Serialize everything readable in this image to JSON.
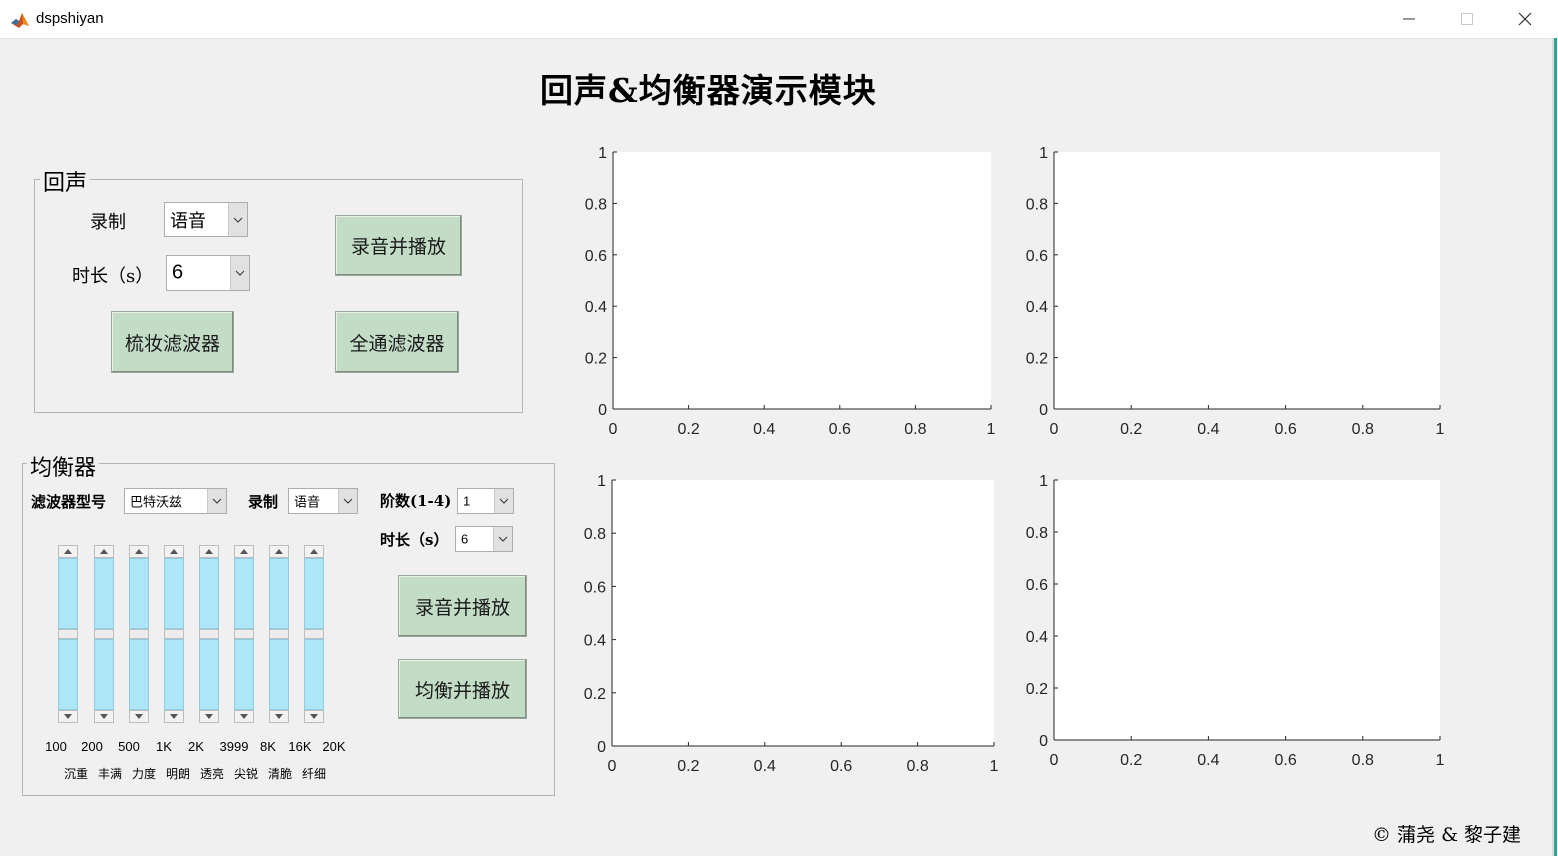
{
  "window": {
    "title": "dspshiyan"
  },
  "main_title": "回声&均衡器演示模块",
  "echo": {
    "panel_title": "回声",
    "record_label": "录制",
    "record_value": "语音",
    "duration_label": "时长（s）",
    "duration_value": "6",
    "record_play_button": "录音并播放",
    "comb_filter_button": "梳妆滤波器",
    "allpass_filter_button": "全通滤波器"
  },
  "equalizer": {
    "panel_title": "均衡器",
    "filter_type_label": "滤波器型号",
    "filter_type_value": "巴特沃兹",
    "record_label": "录制",
    "record_value": "语音",
    "order_label": "阶数(1-4)",
    "order_value": "1",
    "duration_label": "时长（s）",
    "duration_value": "6",
    "record_play_button": "录音并播放",
    "equalize_play_button": "均衡并播放",
    "frequencies": [
      "100",
      "200",
      "500",
      "1K",
      "2K",
      "3999",
      "8K",
      "16K",
      "20K"
    ],
    "band_names": [
      "沉重",
      "丰满",
      "力度",
      "明朗",
      "透亮",
      "尖锐",
      "清脆",
      "纤细"
    ],
    "slider_levels": [
      0.5,
      0.5,
      0.5,
      0.5,
      0.5,
      0.5,
      0.5,
      0.5
    ]
  },
  "axes": {
    "x_ticks": [
      "0",
      "0.2",
      "0.4",
      "0.6",
      "0.8",
      "1"
    ],
    "y_ticks": [
      "0",
      "0.2",
      "0.4",
      "0.6",
      "0.8",
      "1"
    ]
  },
  "copyright": "© 蒲尧 & 黎子建",
  "colors": {
    "button_bg": "#c2dcc6",
    "slider_track": "#aee6f7",
    "background": "#f0f0f0"
  }
}
